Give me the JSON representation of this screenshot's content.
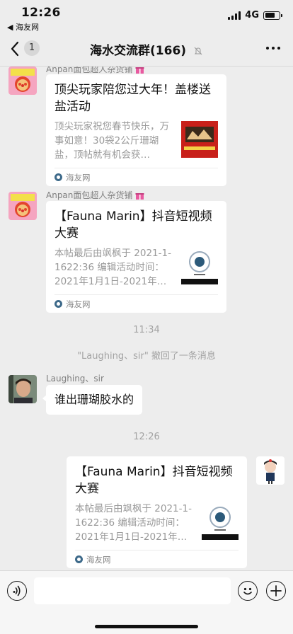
{
  "status_bar": {
    "time": "12:26",
    "back_app": "◀ 海友网",
    "network": "4G",
    "battery_level": 0.7
  },
  "nav": {
    "unread_count": "1",
    "title": "海水交流群(166)"
  },
  "messages": [
    {
      "sender": "Anpan面包超人杂货铺",
      "card": {
        "title": "顶尖玩家陪您过大年！盖楼送盐活动",
        "desc": "顶尖玩家祝您春节快乐，万事如意！30袋2公斤珊瑚盐，顶帖就有机会获…",
        "source": "海友网"
      }
    },
    {
      "sender": "Anpan面包超人杂货铺",
      "card": {
        "title": "【Fauna Marin】抖音短视频大赛",
        "desc": "本帖最后由飒枫于 2021-1-1622:36 编辑活动时间：2021年1月1日-2021年…",
        "source": "海友网"
      }
    }
  ],
  "timestamps": [
    "11:34",
    "12:26"
  ],
  "system_message": "\"Laughing、sir\" 撤回了一条消息",
  "text_message": {
    "sender": "Laughing、sir",
    "text": "谁出珊瑚胶水的"
  },
  "own_message": {
    "card": {
      "title": "【Fauna Marin】抖音短视频大赛",
      "desc": "本帖最后由飒枫于 2021-1-1622:36 编辑活动时间：2021年1月1日-2021年…",
      "source": "海友网"
    }
  },
  "colors": {
    "background": "#ededed",
    "bubble": "#ffffff",
    "meta_text": "#a3a3a3",
    "gift_emoji": "#e85aa0"
  },
  "icons": [
    "back-chevron-icon",
    "mute-icon",
    "more-icon",
    "voice-icon",
    "emoji-icon",
    "plus-icon",
    "source-icon",
    "gift-icon"
  ]
}
